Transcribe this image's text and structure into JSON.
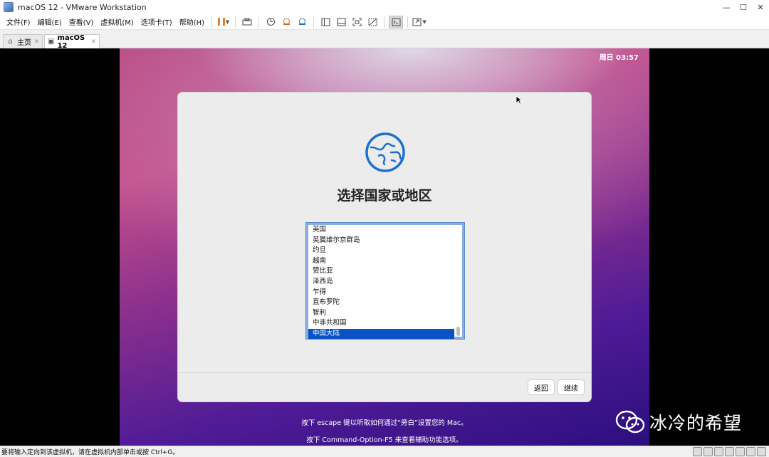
{
  "window": {
    "title": "macOS 12 - VMware Workstation"
  },
  "menu": [
    "文件(F)",
    "编辑(E)",
    "查看(V)",
    "虚拟机(M)",
    "选项卡(T)",
    "帮助(H)"
  ],
  "tabs": [
    {
      "label": "主页"
    },
    {
      "label": "macOS 12"
    }
  ],
  "guest": {
    "clock": "周日 03:57",
    "dialog": {
      "title": "选择国家或地区",
      "countries": [
        "英国",
        "英属维尔京群岛",
        "约旦",
        "越南",
        "赞比亚",
        "泽西岛",
        "乍得",
        "直布罗陀",
        "智利",
        "中非共和国",
        "中国大陆"
      ],
      "selected": "中国大陆",
      "back_label": "返回",
      "continue_label": "继续"
    },
    "hint1": "按下 escape 键以听取如何通过“旁白”设置您的 Mac。",
    "hint2": "按下 Command-Option-F5 来查看辅助功能选项。"
  },
  "watermark": "冰冷的希望",
  "status": {
    "text": "要将输入定向到该虚拟机，请在虚拟机内部单击或按 Ctrl+G。"
  },
  "colors": {
    "selection": "#0852c5",
    "pause": "#ef7d22",
    "globe": "#1d6fd1"
  }
}
